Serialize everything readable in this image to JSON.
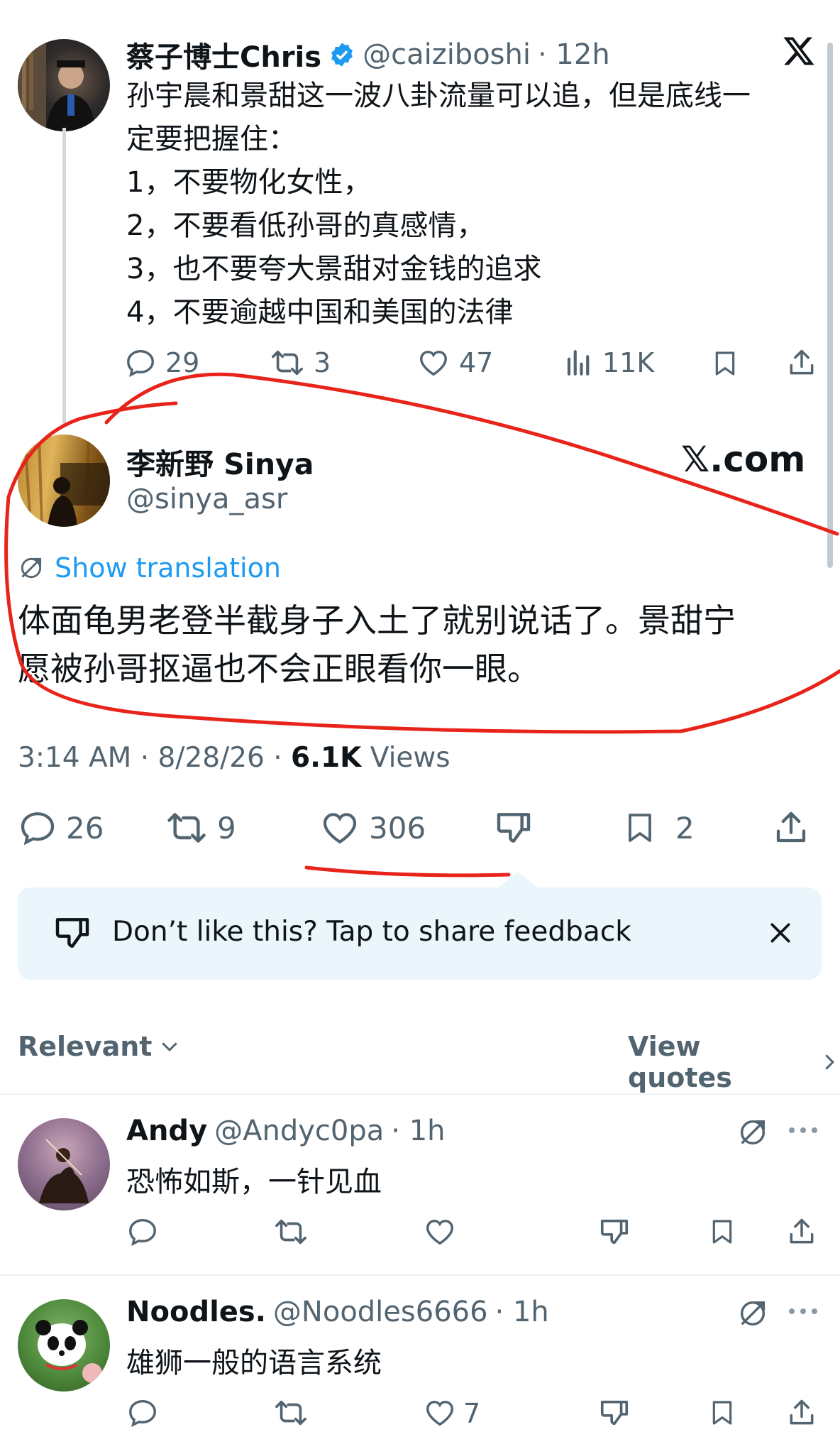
{
  "parent_tweet": {
    "display_name": "蔡子博士Chris",
    "handle": "@caiziboshi",
    "time": "· 12h",
    "lines": [
      "孙宇晨和景甜这一波八卦流量可以追，但是底线一",
      "定要把握住：",
      "1，不要物化女性，",
      "2，不要看低孙哥的真感情，",
      "3，也不要夸大景甜对金钱的追求",
      "4，不要逾越中国和美国的法律"
    ],
    "replies": "29",
    "reposts": "3",
    "likes": "47",
    "views": "11K"
  },
  "main_tweet": {
    "display_name": "李新野 Sinya",
    "handle": "@sinya_asr",
    "watermark": "𝕏.com",
    "translation_label": "Show translation",
    "lines": [
      "体面龟男老登半截身子入土了就别说话了。景甜宁",
      "愿被孙哥抠逼也不会正眼看你一眼。"
    ],
    "timestamp": "3:14 AM · 8/28/26 · ",
    "views_count": "6.1K",
    "views_label": " Views",
    "replies": "26",
    "reposts": "9",
    "likes": "306",
    "bookmarks": "2"
  },
  "feedback": {
    "text": "Don’t like this? Tap to share feedback"
  },
  "sort": {
    "label": "Relevant",
    "view_quotes": "View quotes"
  },
  "replies": [
    {
      "name": "Andy",
      "handle": "@Andyc0pa",
      "time": "· 1h",
      "text": "恐怖如斯，一针见血",
      "likes": ""
    },
    {
      "name": "Noodles.",
      "handle": "@Noodles6666",
      "time": "· 1h",
      "text": "雄狮一般的语言系统",
      "likes": "7"
    }
  ],
  "icons": {
    "x_logo": "x-logo-icon",
    "verified": "verified-badge-icon",
    "translate": "translate-icon",
    "reply": "reply-icon",
    "repost": "repost-icon",
    "like": "heart-icon",
    "views": "views-icon",
    "bookmark": "bookmark-icon",
    "share": "share-icon",
    "dislike": "thumbs-down-icon",
    "close": "close-icon",
    "chevron": "chevron-icon",
    "more": "more-icon"
  },
  "colors": {
    "accent": "#1d9bf0",
    "text": "#0f1419",
    "muted": "#536471",
    "annotation": "#e8231a",
    "feedback_bg": "#eaf6fb"
  }
}
